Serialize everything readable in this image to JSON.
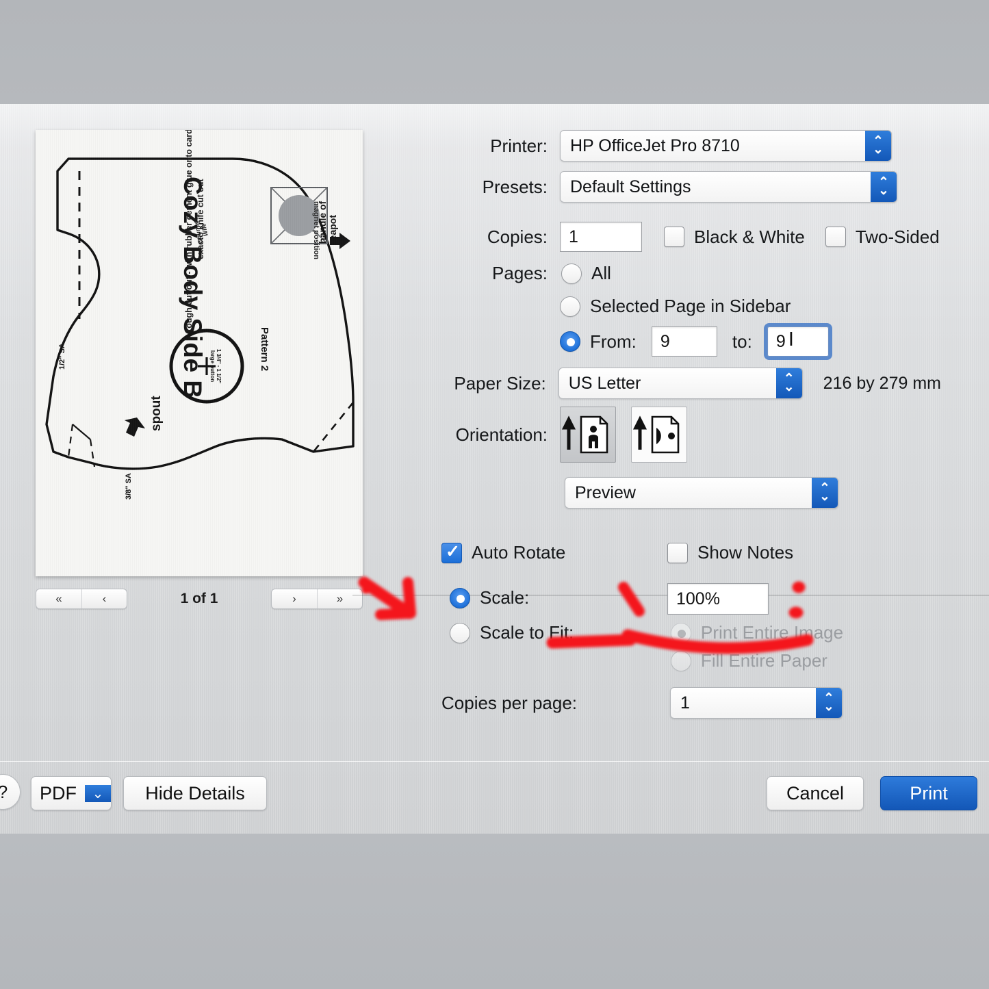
{
  "dialog": {
    "printer": {
      "label": "Printer:",
      "value": "HP OfficeJet Pro 8710"
    },
    "presets": {
      "label": "Presets:",
      "value": "Default Settings"
    },
    "copies": {
      "label": "Copies:",
      "value": "1"
    },
    "black_white": {
      "label": "Black & White",
      "checked": false
    },
    "two_sided": {
      "label": "Two-Sided",
      "checked": false
    },
    "pages": {
      "label": "Pages:",
      "all": "All",
      "selected_page": "Selected Page in Sidebar",
      "from_label": "From:",
      "from_value": "9",
      "to_label": "to:",
      "to_value": "9"
    },
    "paper_size": {
      "label": "Paper Size:",
      "value": "US Letter",
      "dimensions": "216 by 279 mm"
    },
    "orientation": {
      "label": "Orientation:",
      "portrait_icon": "portrait-orientation-icon",
      "landscape_icon": "landscape-orientation-icon"
    },
    "app_popup": {
      "value": "Preview"
    },
    "auto_rotate": {
      "label": "Auto Rotate",
      "checked": true
    },
    "show_notes": {
      "label": "Show Notes",
      "checked": false
    },
    "scale": {
      "label": "Scale:",
      "value": "100%",
      "selected": true
    },
    "scale_to_fit": {
      "label": "Scale to Fit:",
      "selected": false
    },
    "print_entire_image": {
      "label": "Print Entire Image",
      "selected": true,
      "disabled": true
    },
    "fill_entire_paper": {
      "label": "Fill Entire Paper",
      "selected": false,
      "disabled": true
    },
    "copies_per_page": {
      "label": "Copies per page:",
      "value": "1"
    }
  },
  "preview": {
    "nav": {
      "first": "«",
      "prev": "‹",
      "next": "›",
      "last": "»",
      "counter": "1 of 1"
    },
    "document": {
      "title": "Cozy Body Side B",
      "pattern_number": "Pattern 2",
      "handle_label": "handle of\nteapot",
      "magnet_label": "magnet position",
      "spout_label": "spout",
      "seam_allowance_bottom": "1/2\" SA",
      "seam_allowance_side": "3/8\" SA",
      "button_note": "1 3/4\" - 1 1/2\"\nlarge button",
      "instructions": "rough cut out - with rubber cement glue onto cardstock\nexacto knife cut out",
      "brand": "Gourmet\nWife"
    }
  },
  "bottom_bar": {
    "help": "?",
    "pdf": "PDF",
    "pdf_arrow": "chevron-down-icon",
    "hide_details": "Hide Details",
    "cancel": "Cancel",
    "print": "Print"
  },
  "colors": {
    "accent_blue": "#1358b8",
    "annotation_red": "#f4131a",
    "dialog_grey": "#d8dadc",
    "photo_band_grey": "#b5b8bc"
  },
  "annotations": {
    "arrow": "red-arrow-annotation",
    "underline_scale": "red-underline-scale",
    "underline_print_entire_image": "red-underline-print-entire-image",
    "tick": "red-tick-mark",
    "dot_upper": "red-dot-upper",
    "dot_lower": "red-dot-lower"
  }
}
